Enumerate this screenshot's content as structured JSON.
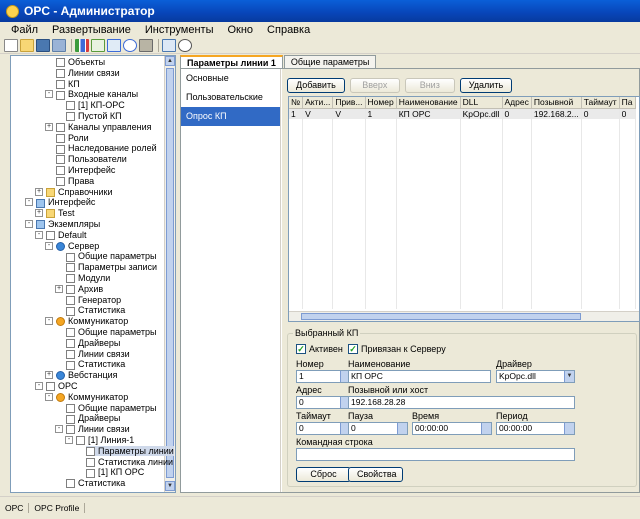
{
  "window": {
    "title": "OPC - Администратор"
  },
  "menu": [
    "Файл",
    "Развертывание",
    "Инструменты",
    "Окно",
    "Справка"
  ],
  "toolbar": {
    "icons": [
      "new-icon",
      "open-icon",
      "save-icon",
      "save-all-icon",
      "sep",
      "chart-icon",
      "export-icon",
      "import-icon",
      "help-icon",
      "settings-icon",
      "sep",
      "transfer-icon",
      "search-icon"
    ]
  },
  "tree": {
    "items": [
      {
        "label": "Объекты",
        "indent": 3,
        "icon": "doc"
      },
      {
        "label": "Линии связи",
        "indent": 3,
        "icon": "doc"
      },
      {
        "label": "КП",
        "indent": 3,
        "icon": "doc"
      },
      {
        "label": "Входные каналы",
        "indent": 3,
        "icon": "doc",
        "exp": "-"
      },
      {
        "label": "[1] КП-OPC",
        "indent": 4,
        "icon": "doc"
      },
      {
        "label": "Пустой КП",
        "indent": 4,
        "icon": "doc"
      },
      {
        "label": "Каналы управления",
        "indent": 3,
        "icon": "doc",
        "exp": "+"
      },
      {
        "label": "Роли",
        "indent": 3,
        "icon": "doc"
      },
      {
        "label": "Наследование ролей",
        "indent": 3,
        "icon": "doc"
      },
      {
        "label": "Пользователи",
        "indent": 3,
        "icon": "doc"
      },
      {
        "label": "Интерфейс",
        "indent": 3,
        "icon": "doc"
      },
      {
        "label": "Права",
        "indent": 3,
        "icon": "doc"
      },
      {
        "label": "Справочники",
        "indent": 2,
        "icon": "folder",
        "exp": "+"
      },
      {
        "label": "Интерфейс",
        "indent": 1,
        "icon": "computer",
        "exp": "-"
      },
      {
        "label": "Test",
        "indent": 2,
        "icon": "folder",
        "exp": "+"
      },
      {
        "label": "Экземпляры",
        "indent": 1,
        "icon": "computer",
        "exp": "-"
      },
      {
        "label": "Default",
        "indent": 2,
        "icon": "doc",
        "exp": "-"
      },
      {
        "label": "Сервер",
        "indent": 3,
        "icon": "gear",
        "exp": "-"
      },
      {
        "label": "Общие параметры",
        "indent": 4,
        "icon": "doc"
      },
      {
        "label": "Параметры записи",
        "indent": 4,
        "icon": "doc"
      },
      {
        "label": "Модули",
        "indent": 4,
        "icon": "doc"
      },
      {
        "label": "Архив",
        "indent": 4,
        "icon": "doc",
        "exp": "+"
      },
      {
        "label": "Генератор",
        "indent": 4,
        "icon": "doc"
      },
      {
        "label": "Статистика",
        "indent": 4,
        "icon": "doc"
      },
      {
        "label": "Коммуникатор",
        "indent": 3,
        "icon": "star",
        "exp": "-"
      },
      {
        "label": "Общие параметры",
        "indent": 4,
        "icon": "doc"
      },
      {
        "label": "Драйверы",
        "indent": 4,
        "icon": "doc"
      },
      {
        "label": "Линии связи",
        "indent": 4,
        "icon": "doc"
      },
      {
        "label": "Статистика",
        "indent": 4,
        "icon": "doc"
      },
      {
        "label": "Вебстанция",
        "indent": 3,
        "icon": "gear",
        "exp": "+"
      },
      {
        "label": "OPC",
        "indent": 2,
        "icon": "doc",
        "exp": "-"
      },
      {
        "label": "Коммуникатор",
        "indent": 3,
        "icon": "star",
        "exp": "-"
      },
      {
        "label": "Общие параметры",
        "indent": 4,
        "icon": "doc"
      },
      {
        "label": "Драйверы",
        "indent": 4,
        "icon": "doc"
      },
      {
        "label": "Линии связи",
        "indent": 4,
        "icon": "doc",
        "exp": "-"
      },
      {
        "label": "[1] Линия-1",
        "indent": 5,
        "icon": "doc",
        "exp": "-"
      },
      {
        "label": "Параметры линии",
        "indent": 6,
        "icon": "doc",
        "selected": true
      },
      {
        "label": "Статистика линии",
        "indent": 6,
        "icon": "doc"
      },
      {
        "label": "[1] КП OPC",
        "indent": 6,
        "icon": "doc"
      },
      {
        "label": "Статистика",
        "indent": 4,
        "icon": "doc"
      }
    ]
  },
  "tabs": [
    {
      "label": "Параметры линии 1",
      "active": true
    },
    {
      "label": "Общие параметры",
      "active": false
    }
  ],
  "subnav": [
    {
      "label": "Основные",
      "selected": false
    },
    {
      "label": "Пользовательские",
      "selected": false
    },
    {
      "label": "Опрос КП",
      "selected": true
    }
  ],
  "buttons": {
    "add": "Добавить",
    "up": "Вверх",
    "down": "Вниз",
    "delete": "Удалить"
  },
  "grid": {
    "columns": [
      "№",
      "Акти...",
      "Прив...",
      "Номер",
      "Наименование",
      "DLL",
      "Адрес",
      "Позывной",
      "Таймаут",
      "Па"
    ],
    "rows": [
      [
        "1",
        "V",
        "V",
        "1",
        "КП OPC",
        "KpOpc.dll",
        "0",
        "192.168.2...",
        "0",
        "0"
      ]
    ]
  },
  "selected_kp": {
    "group_title": "Выбранный КП",
    "active_label": "Активен",
    "active_checked": true,
    "bound_label": "Привязан к Серверу",
    "bound_checked": true,
    "number_label": "Номер",
    "number_value": "1",
    "name_label": "Наименование",
    "name_value": "КП OPC",
    "driver_label": "Драйвер",
    "driver_value": "KpOpc.dll",
    "address_label": "Адрес",
    "address_value": "0",
    "callnum_label": "Позывной или хост",
    "callnum_value": "192.168.28.28",
    "timeout_label": "Таймаут",
    "timeout_value": "0",
    "delay_label": "Пауза",
    "delay_value": "0",
    "time_label": "Время",
    "time_value": "00:00:00",
    "period_label": "Период",
    "period_value": "00:00:00",
    "cmdline_label": "Командная строка",
    "cmdline_value": "",
    "reset_button": "Сброс",
    "props_button": "Свойства"
  },
  "statusbar": [
    "OPC",
    "OPC Profile"
  ]
}
